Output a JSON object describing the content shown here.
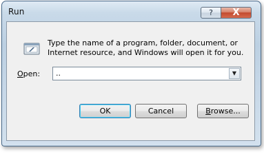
{
  "window": {
    "title": "Run",
    "help_label": "?",
    "close_label": "X"
  },
  "dialog": {
    "description": "Type the name of a program, folder, document, or Internet resource, and Windows will open it for you.",
    "icon": "run-icon",
    "open_label_underlined": "O",
    "open_label_rest": "pen:",
    "open_value": "..",
    "dropdown_icon": "chevron-down-icon"
  },
  "buttons": {
    "ok": "OK",
    "cancel": "Cancel",
    "browse_underlined": "B",
    "browse_rest": "rowse..."
  },
  "colors": {
    "close_button": "#c24a2e",
    "ok_border": "#3c7fb1"
  }
}
